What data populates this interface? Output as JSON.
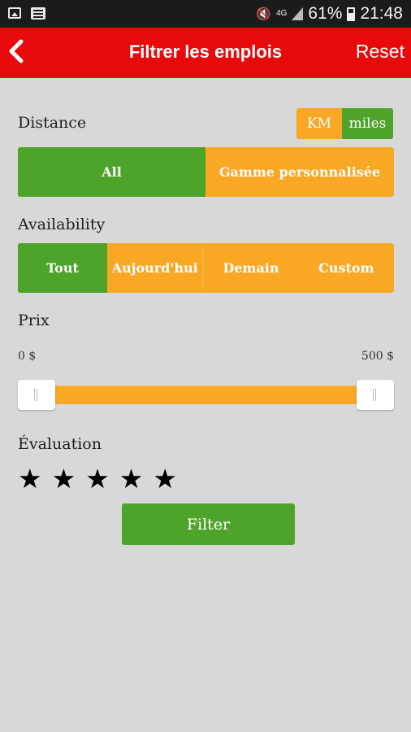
{
  "colors": {
    "accent": "#e8090b",
    "green": "#4ea42b",
    "orange": "#f9a826",
    "background": "#d8d8d8"
  },
  "status_bar": {
    "network": "4G",
    "battery": "61%",
    "time": "21:48"
  },
  "header": {
    "title": "Filtrer les emplois",
    "reset_label": "Reset",
    "back_icon": "chevron-left-icon"
  },
  "distance": {
    "label": "Distance",
    "units": [
      {
        "label": "KM",
        "selected": false
      },
      {
        "label": "miles",
        "selected": true
      }
    ],
    "options": [
      {
        "label": "All",
        "selected": true
      },
      {
        "label": "Gamme personnalisée",
        "selected": false
      }
    ]
  },
  "availability": {
    "label": "Availability",
    "options": [
      {
        "label": "Tout",
        "selected": true
      },
      {
        "label": "Aujourd'hui",
        "selected": false
      },
      {
        "label": "Demain",
        "selected": false
      },
      {
        "label": "Custom",
        "selected": false
      }
    ]
  },
  "price": {
    "label": "Prix",
    "min_label": "0 $",
    "max_label": "500 $",
    "range_min": 0,
    "range_max": 500,
    "selected_min": 0,
    "selected_max": 500
  },
  "rating": {
    "label": "Évaluation",
    "star_count": 5,
    "star_glyph": "★"
  },
  "filter_button": {
    "label": "Filter"
  }
}
